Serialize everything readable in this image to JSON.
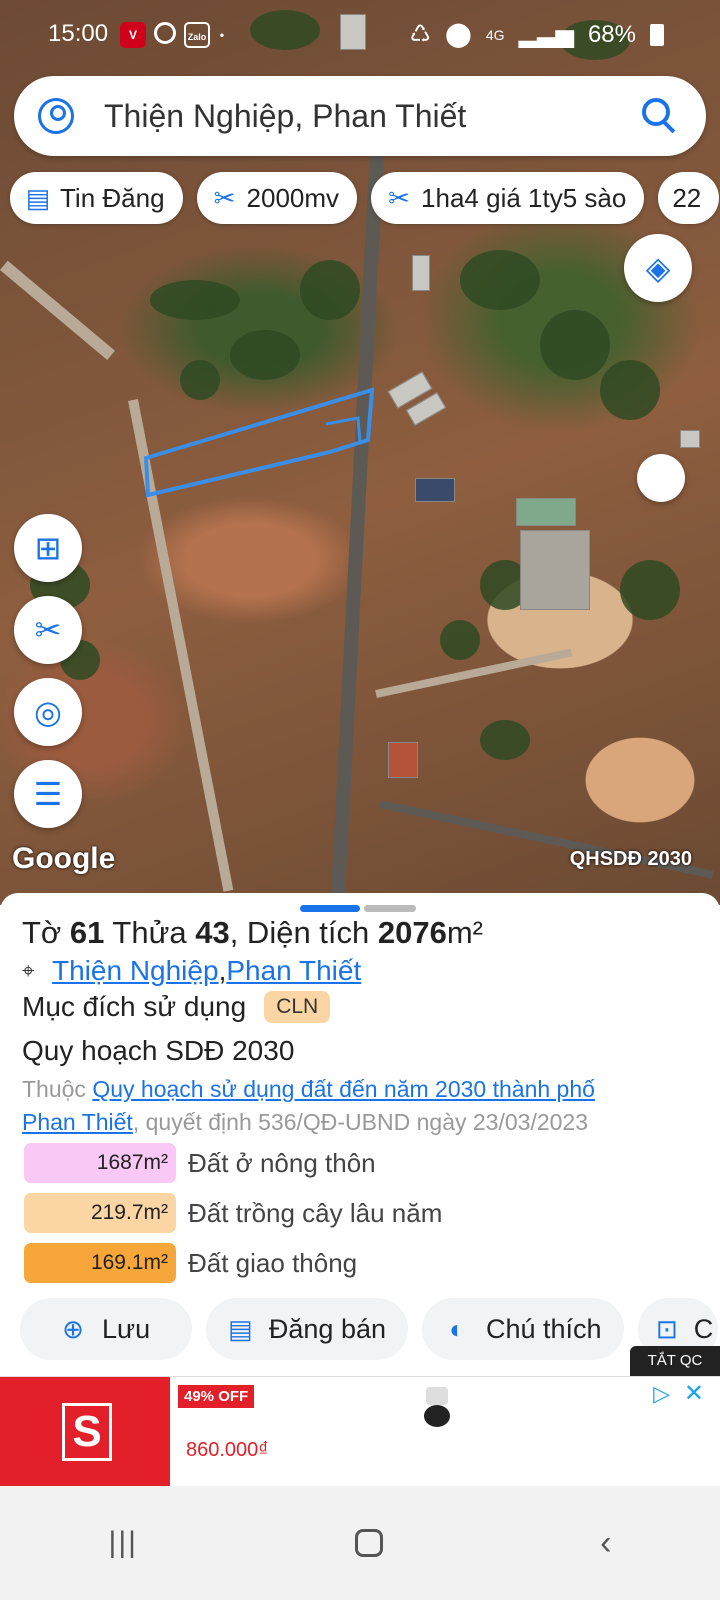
{
  "status_bar": {
    "time": "15:00",
    "network": "4G",
    "battery": "68%"
  },
  "search": {
    "query": "Thiện Nghiệp, Phan Thiết"
  },
  "chips": [
    {
      "icon": "list-icon",
      "label": "Tin Đăng"
    },
    {
      "icon": "ruler-icon",
      "label": "2000mv"
    },
    {
      "icon": "ruler-icon",
      "label": "1ha4 giá 1ty5 sào"
    },
    {
      "icon": "",
      "label": "22"
    }
  ],
  "map": {
    "logo": "Google",
    "plan_label": "QHSDĐ 2030"
  },
  "parcel": {
    "sheet_prefix": "Tờ ",
    "sheet_no": "61",
    "plot_prefix": " Thửa ",
    "plot_no": "43",
    "area_prefix": ", Diện tích ",
    "area_value": "2076",
    "area_unit": "m²",
    "ward": "Thiện Nghiệp",
    "city": "Phan Thiết",
    "purpose_label": "Mục đích sử dụng",
    "purpose_code": "CLN",
    "plan_title": "Quy hoạch SDĐ 2030",
    "plan_desc_prefix": "Thuộc ",
    "plan_link_1": "Quy hoạch sử dụng đất đến năm 2030 thành phố",
    "plan_link_2": "Phan Thiết",
    "plan_desc_suffix": ", quyết định 536/QĐ-UBND ngày 23/03/2023"
  },
  "land_uses": [
    {
      "area": "1687m²",
      "label": "Đất ở nông thôn",
      "color": "#f9c8f5"
    },
    {
      "area": "219.7m²",
      "label": "Đất trồng cây lâu năm",
      "color": "#fbd5a3"
    },
    {
      "area": "169.1m²",
      "label": "Đất giao thông",
      "color": "#f7a73a"
    }
  ],
  "actions": [
    {
      "icon": "file-plus-icon",
      "label": "Lưu"
    },
    {
      "icon": "list-icon",
      "label": "Đăng bán"
    },
    {
      "icon": "contrast-icon",
      "label": "Chú thích"
    },
    {
      "icon": "camera-icon",
      "label": "C"
    }
  ],
  "ad": {
    "toggle": "TẮT QC",
    "discount": "49% OFF",
    "price": "860.000₫",
    "brand_letter": "S"
  },
  "colors": {
    "accent": "#1a73e8",
    "parcel_outline": "#3a8ee6"
  }
}
